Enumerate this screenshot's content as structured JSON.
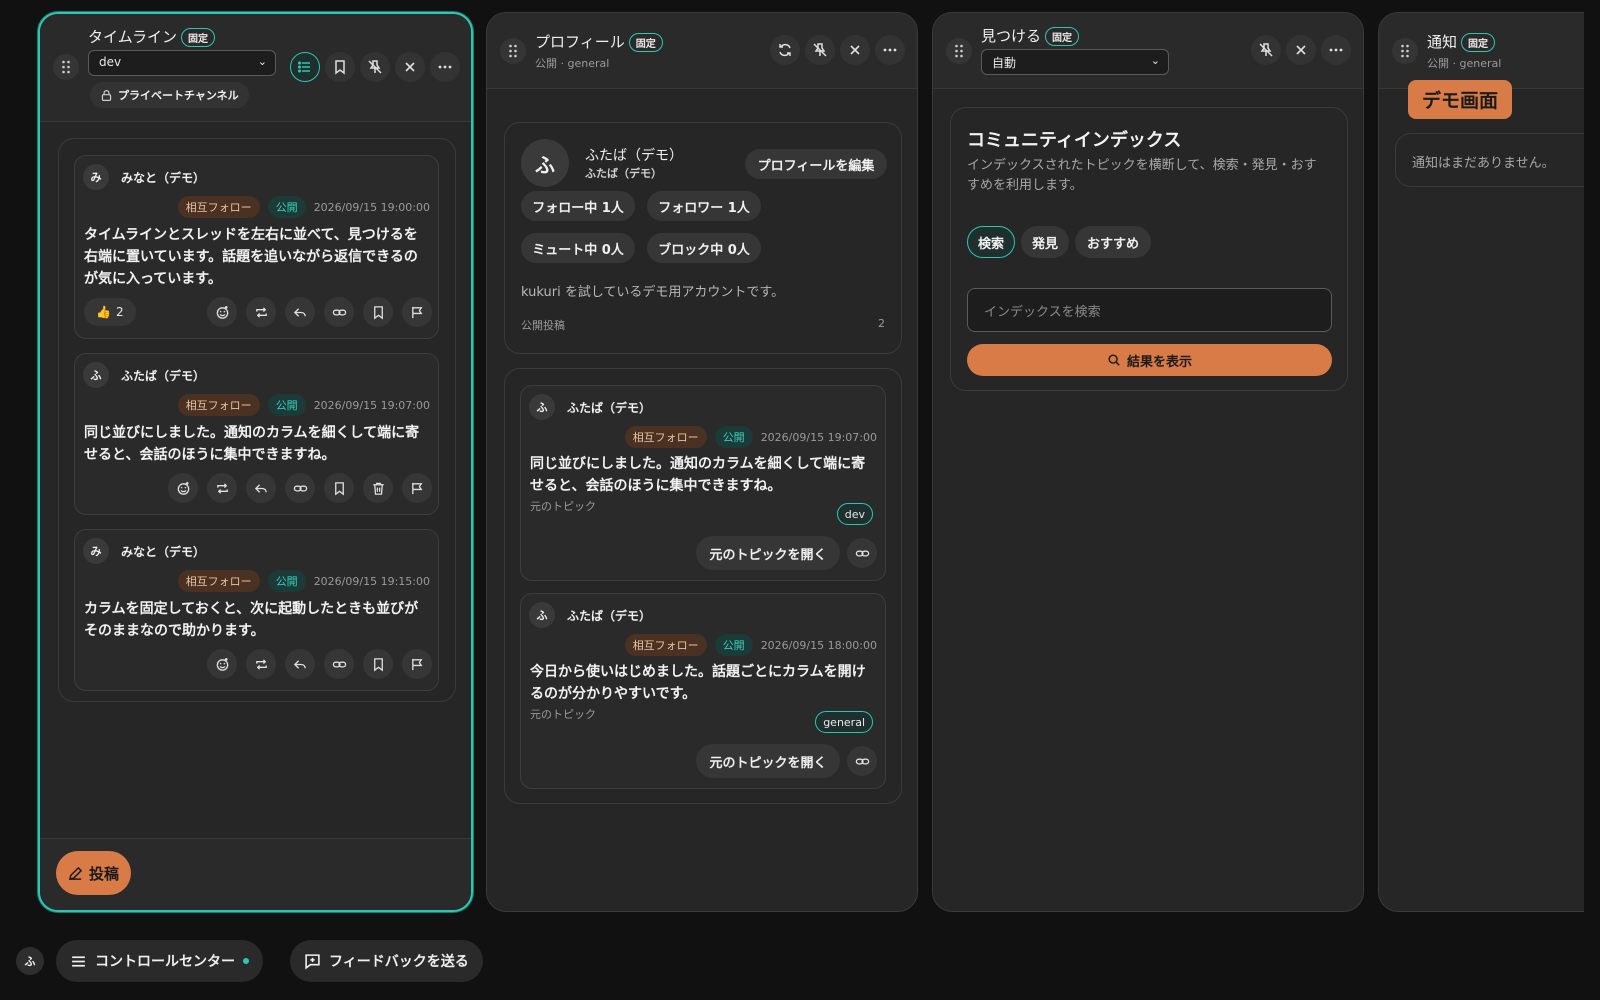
{
  "timeline": {
    "title": "タイムライン",
    "pin_badge": "固定",
    "channel_select": "dev",
    "private_channel": "プライベートチャンネル",
    "posts": [
      {
        "avatar": "み",
        "author": "みなと（デモ）",
        "relationship": "相互フォロー",
        "visibility": "公開",
        "timestamp": "2026/09/15 19:00:00",
        "body": "タイムラインとスレッドを左右に並べて、見つけるを右端に置いています。話題を追いながら返信できるのが気に入っています。",
        "reaction_count": "2"
      },
      {
        "avatar": "ふ",
        "author": "ふたば（デモ）",
        "relationship": "相互フォロー",
        "visibility": "公開",
        "timestamp": "2026/09/15 19:07:00",
        "body": "同じ並びにしました。通知のカラムを細くして端に寄せると、会話のほうに集中できますね。"
      },
      {
        "avatar": "み",
        "author": "みなと（デモ）",
        "relationship": "相互フォロー",
        "visibility": "公開",
        "timestamp": "2026/09/15 19:15:00",
        "body": "カラムを固定しておくと、次に起動したときも並びがそのままなので助かります。"
      }
    ],
    "compose_label": "投稿"
  },
  "profile": {
    "title": "プロフィール",
    "pin_badge": "固定",
    "subtitle": "公開 · general",
    "avatar": "ふ",
    "display_name": "ふたば（デモ）",
    "handle": "ふたば（デモ）",
    "edit_label": "プロフィールを編集",
    "following": "フォロー中 1人",
    "followers": "フォロワー 1人",
    "muted": "ミュート中 0人",
    "blocked": "ブロック中 0人",
    "bio": "kukuri を試しているデモ用アカウントです。",
    "posts_label": "公開投稿",
    "posts_count": "2",
    "open_topic_label": "元のトピックを開く",
    "origin_topic_label": "元のトピック",
    "posts": [
      {
        "avatar": "ふ",
        "author": "ふたば（デモ）",
        "relationship": "相互フォロー",
        "visibility": "公開",
        "timestamp": "2026/09/15 19:07:00",
        "body": "同じ並びにしました。通知のカラムを細くして端に寄せると、会話のほうに集中できますね。",
        "topic": "dev"
      },
      {
        "avatar": "ふ",
        "author": "ふたば（デモ）",
        "relationship": "相互フォロー",
        "visibility": "公開",
        "timestamp": "2026/09/15 18:00:00",
        "body": "今日から使いはじめました。話題ごとにカラムを開けるのが分かりやすいです。",
        "topic": "general"
      }
    ]
  },
  "discover": {
    "title": "見つける",
    "pin_badge": "固定",
    "mode_select": "自動",
    "card_title": "コミュニティインデックス",
    "card_desc": "インデックスされたトピックを横断して、検索・発見・おすすめを利用します。",
    "tabs": [
      "検索",
      "発見",
      "おすすめ"
    ],
    "search_placeholder": "インデックスを検索",
    "show_results": "結果を表示"
  },
  "notifications": {
    "title": "通知",
    "pin_badge": "固定",
    "subtitle": "公開 · general",
    "empty": "通知はまだありません。"
  },
  "demo_badge": "デモ画面",
  "bottom": {
    "user_avatar": "ふ",
    "control_center": "コントロールセンター",
    "feedback": "フィードバックを送る"
  },
  "colors": {
    "accent_teal": "#2cc6b4",
    "accent_orange": "#d97b47",
    "background": "#111111"
  }
}
